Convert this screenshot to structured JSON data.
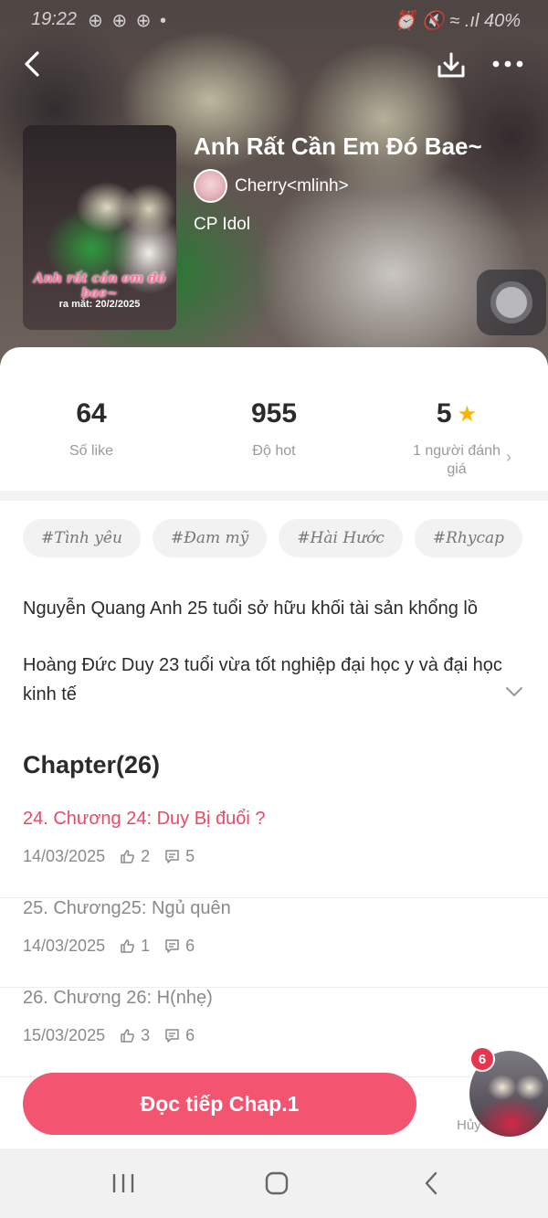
{
  "status_bar": {
    "time": "19:22",
    "apps": "⊕ ⊕ ⊕ •",
    "right": "⏰ 🔇 ≈ .ıl 40%"
  },
  "book": {
    "title": "Anh Rất Cần Em Đó Bae~",
    "author": "Cherry<mlinh>",
    "category": "CP Idol",
    "cover_title": "Anh rất cần em đó bae~",
    "cover_date": "ra mắt: 20/2/2025"
  },
  "stats": [
    {
      "value": "64",
      "label": "Số like"
    },
    {
      "value": "955",
      "label": "Độ hot"
    },
    {
      "value": "5",
      "label": "1 người đánh giá"
    }
  ],
  "tags": [
    "#Tình yêu",
    "#Đam mỹ",
    "#Hài Hước",
    "#Rhycap"
  ],
  "description": [
    "Nguyễn Quang Anh 25 tuổi sở hữu khối tài sản khổng lồ",
    "Hoàng Đức Duy 23 tuổi vừa tốt nghiệp đại học y và đại học kinh tế"
  ],
  "chapters_header": "Chapter(26)",
  "chapters": [
    {
      "title": "24. Chương 24: Duy Bị đuổi ?",
      "date": "14/03/2025",
      "likes": "2",
      "comments": "5",
      "current": true
    },
    {
      "title": "25. Chương25: Ngủ quên",
      "date": "14/03/2025",
      "likes": "1",
      "comments": "6",
      "current": false
    },
    {
      "title": "26. Chương 26: H(nhẹ)",
      "date": "15/03/2025",
      "likes": "3",
      "comments": "6",
      "current": false
    }
  ],
  "cta_label": "Đọc tiếp Chap.1",
  "float_badge": "6",
  "cancel_label": "Hủy",
  "colors": {
    "accent": "#f3546f",
    "current_chapter": "#e94a66",
    "star": "#f7b500"
  },
  "icons": {
    "back": "back-arrow-icon",
    "download": "download-icon",
    "more": "more-dots-icon",
    "star": "star-icon",
    "expand": "chevron-down-icon",
    "like": "thumbs-up-icon",
    "comment": "comment-icon"
  }
}
